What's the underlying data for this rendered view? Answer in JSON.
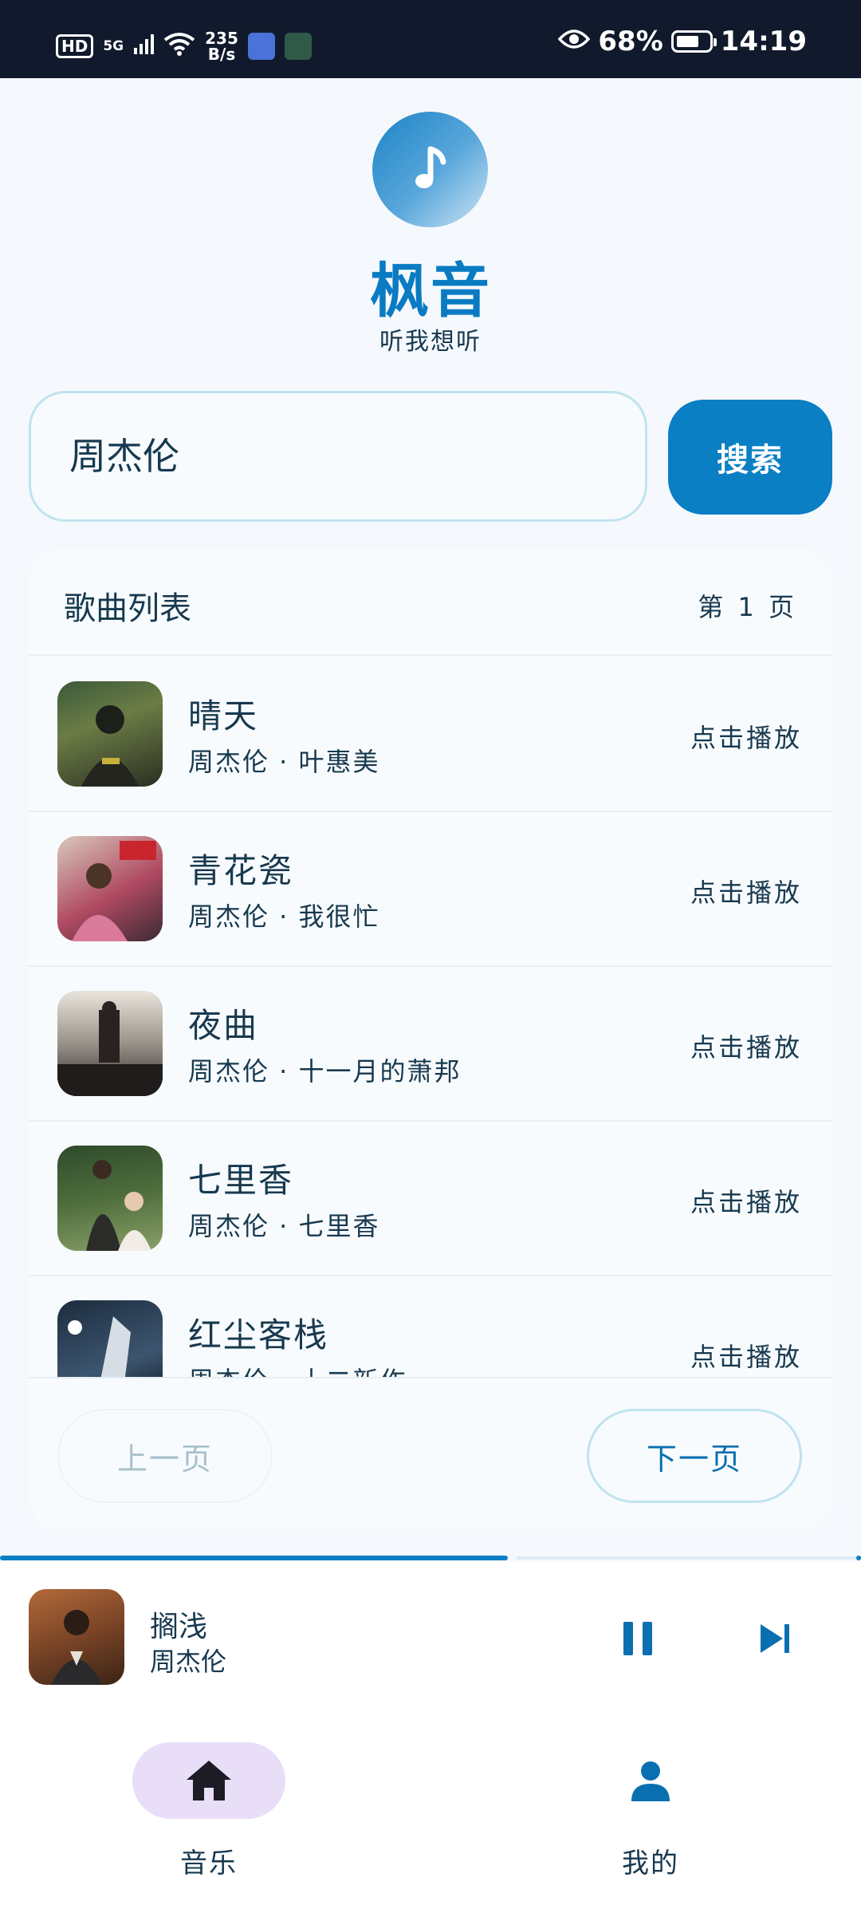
{
  "status_bar": {
    "hd": "HD",
    "signal": "5G",
    "net_speed_value": "235",
    "net_speed_unit": "B/s",
    "battery": "68%",
    "time": "14:19"
  },
  "header": {
    "app_name": "枫音",
    "tagline": "听我想听"
  },
  "search": {
    "query": "周杰伦",
    "button_label": "搜索"
  },
  "song_list": {
    "title": "歌曲列表",
    "page_indicator": "第 1 页",
    "items": [
      {
        "title": "晴天",
        "subtitle": "周杰伦 · 叶惠美",
        "action": "点击播放"
      },
      {
        "title": "青花瓷",
        "subtitle": "周杰伦 · 我很忙",
        "action": "点击播放"
      },
      {
        "title": "夜曲",
        "subtitle": "周杰伦 · 十一月的萧邦",
        "action": "点击播放"
      },
      {
        "title": "七里香",
        "subtitle": "周杰伦 · 七里香",
        "action": "点击播放"
      },
      {
        "title": "红尘客栈",
        "subtitle": "周杰伦 · 十二新作",
        "action": "点击播放"
      }
    ],
    "prev_label": "上一页",
    "next_label": "下一页"
  },
  "player": {
    "title": "搁浅",
    "artist": "周杰伦",
    "progress": 0.59
  },
  "bottom_nav": {
    "items": [
      {
        "label": "音乐",
        "icon": "home-icon",
        "active": true
      },
      {
        "label": "我的",
        "icon": "person-icon",
        "active": false
      }
    ]
  },
  "colors": {
    "accent": "#0a7fc4",
    "text": "#17394f",
    "background": "#f5f9fd",
    "nav_active_pill": "#e8def8"
  }
}
